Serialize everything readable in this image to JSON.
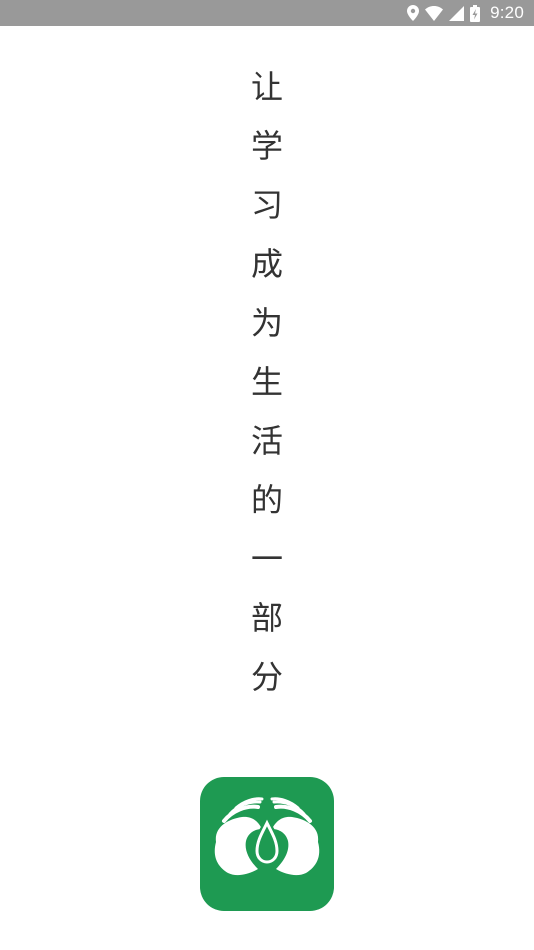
{
  "status_bar": {
    "time": "9:20",
    "icons": [
      "location-icon",
      "wifi-icon",
      "cell-signal-icon",
      "battery-charging-icon"
    ],
    "background": "#999999"
  },
  "slogan": {
    "chars": [
      "让",
      "学",
      "习",
      "成",
      "为",
      "生",
      "活",
      "的",
      "一",
      "部",
      "分"
    ]
  },
  "logo": {
    "name": "app-logo-icon",
    "background": "#1e9a52"
  }
}
